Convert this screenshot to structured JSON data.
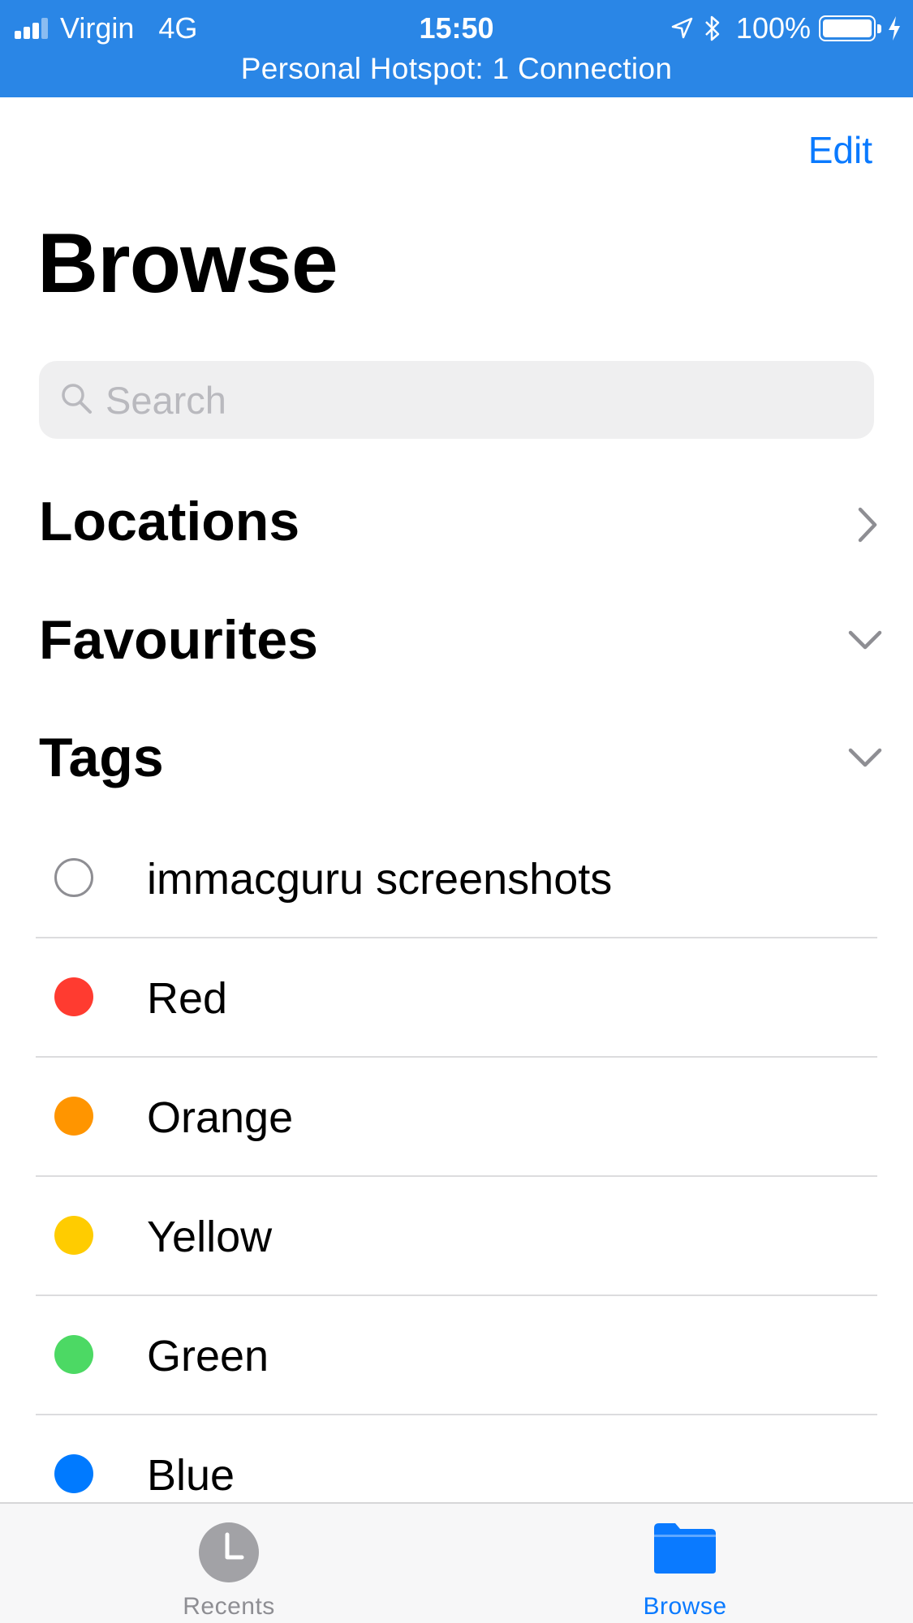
{
  "status_bar": {
    "carrier": "Virgin",
    "network": "4G",
    "time": "15:50",
    "battery": "100%",
    "hotspot": "Personal Hotspot: 1 Connection",
    "color": "#2a86e6"
  },
  "nav": {
    "edit_label": "Edit",
    "title": "Browse"
  },
  "search": {
    "placeholder": "Search",
    "value": ""
  },
  "sections": {
    "locations": {
      "label": "Locations",
      "icon": "chevron-right-icon"
    },
    "favourites": {
      "label": "Favourites",
      "icon": "chevron-down-icon"
    },
    "tags": {
      "label": "Tags",
      "icon": "chevron-down-icon"
    }
  },
  "tags": [
    {
      "label": "immacguru screenshots",
      "color": "none"
    },
    {
      "label": "Red",
      "color": "#ff3b30"
    },
    {
      "label": "Orange",
      "color": "#ff9500"
    },
    {
      "label": "Yellow",
      "color": "#ffcc00"
    },
    {
      "label": "Green",
      "color": "#4cd964"
    },
    {
      "label": "Blue",
      "color": "#007aff"
    }
  ],
  "tab_bar": {
    "recents_label": "Recents",
    "browse_label": "Browse",
    "active": "Browse",
    "accent": "#0a7aff"
  }
}
